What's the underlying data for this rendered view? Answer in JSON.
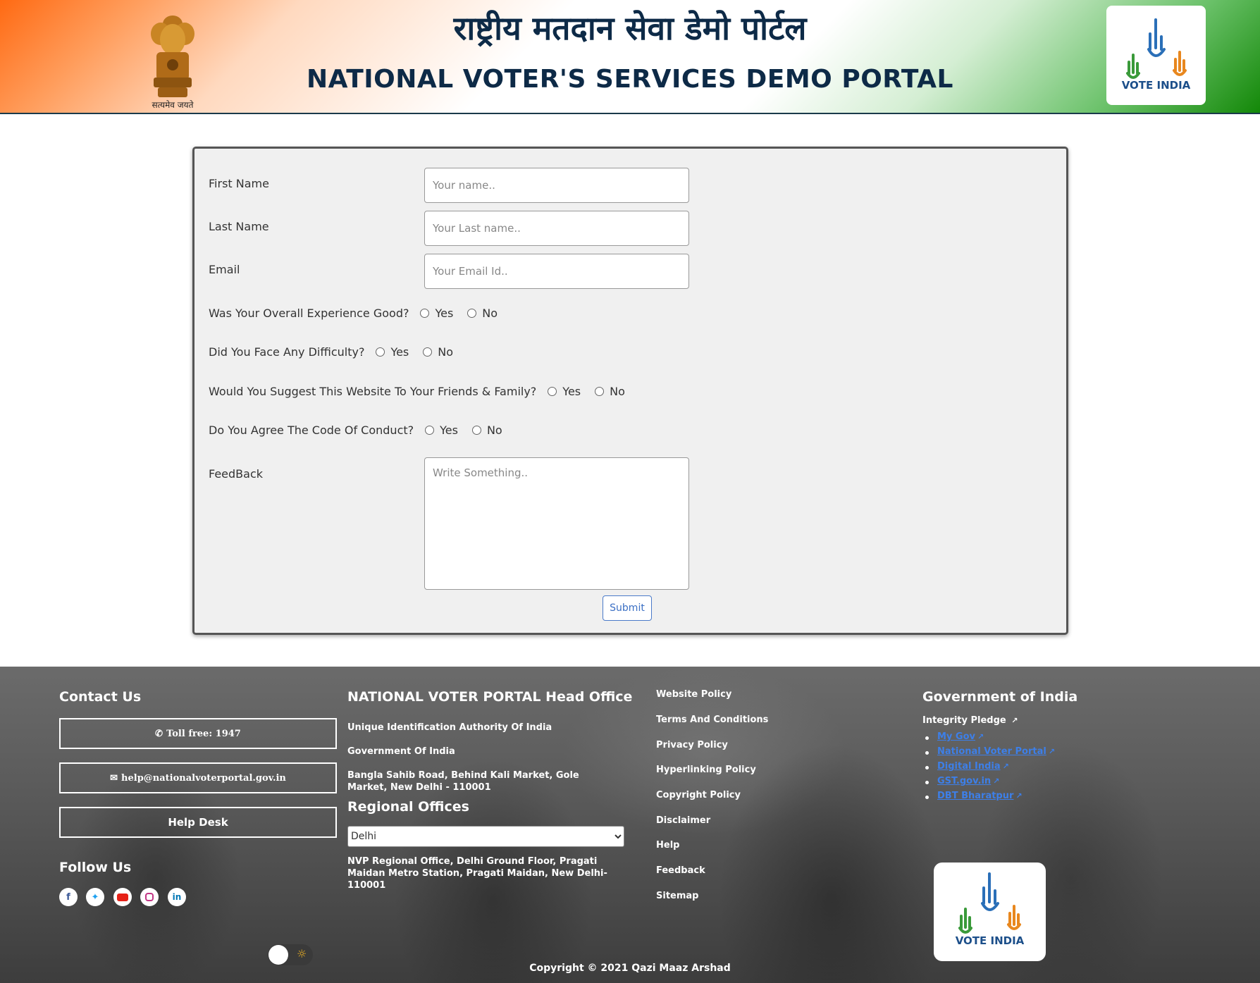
{
  "header": {
    "title_hindi": "राष्ट्रीय मतदान सेवा डेमो पोर्टल",
    "title_english": "NATIONAL VOTER'S SERVICES DEMO PORTAL",
    "emblem_caption": "सत्यमेव जयते",
    "logo_text": "VOTE INDIA"
  },
  "form": {
    "first_name": {
      "label": "First Name",
      "placeholder": "Your name.."
    },
    "last_name": {
      "label": "Last Name",
      "placeholder": "Your Last name.."
    },
    "email": {
      "label": "Email",
      "placeholder": "Your Email Id.."
    },
    "questions": [
      {
        "label": "Was Your Overall Experience Good?",
        "yes": "Yes",
        "no": "No"
      },
      {
        "label": "Did You Face Any Difficulty?",
        "yes": "Yes",
        "no": "No"
      },
      {
        "label": "Would You Suggest This Website To Your Friends & Family?",
        "yes": "Yes",
        "no": "No"
      },
      {
        "label": "Do You Agree The Code Of Conduct?",
        "yes": "Yes",
        "no": "No"
      }
    ],
    "feedback": {
      "label": "FeedBack",
      "placeholder": "Write Something.."
    },
    "submit_label": "Submit"
  },
  "footer": {
    "contact": {
      "heading": "Contact Us",
      "toll_free": "Toll free: 1947",
      "email": "help@nationalvoterportal.gov.in",
      "help_desk": "Help Desk"
    },
    "follow": {
      "heading": "Follow Us",
      "icons": [
        "facebook-icon",
        "twitter-icon",
        "youtube-icon",
        "instagram-icon",
        "linkedin-icon"
      ]
    },
    "head_office": {
      "heading": "NATIONAL VOTER PORTAL Head Office",
      "line1": "Unique Identification Authority Of India",
      "line2": "Government Of India",
      "address": "Bangla Sahib Road, Behind Kali Market, Gole Market, New Delhi - 110001"
    },
    "regional": {
      "heading": "Regional Offices",
      "selected": "Delhi",
      "address": "NVP Regional Office, Delhi Ground Floor, Pragati Maidan Metro Station, Pragati Maidan, New Delhi-110001"
    },
    "links": [
      "Website Policy",
      "Terms And Conditions",
      "Privacy Policy",
      "Hyperlinking Policy",
      "Copyright Policy",
      "Disclaimer",
      "Help",
      "Feedback",
      "Sitemap"
    ],
    "government": {
      "heading": "Government of India",
      "pledge": "Integrity Pledge",
      "links": [
        "My Gov",
        "National Voter Portal",
        "Digital India",
        "GST.gov.in",
        "DBT Bharatpur"
      ]
    },
    "copyright": "Copyright © 2021 Qazi Maaz Arshad"
  },
  "colors": {
    "saffron": "#ff6a13",
    "green": "#138808",
    "navy": "#0d2a47",
    "link_blue": "#3d7fe8"
  }
}
